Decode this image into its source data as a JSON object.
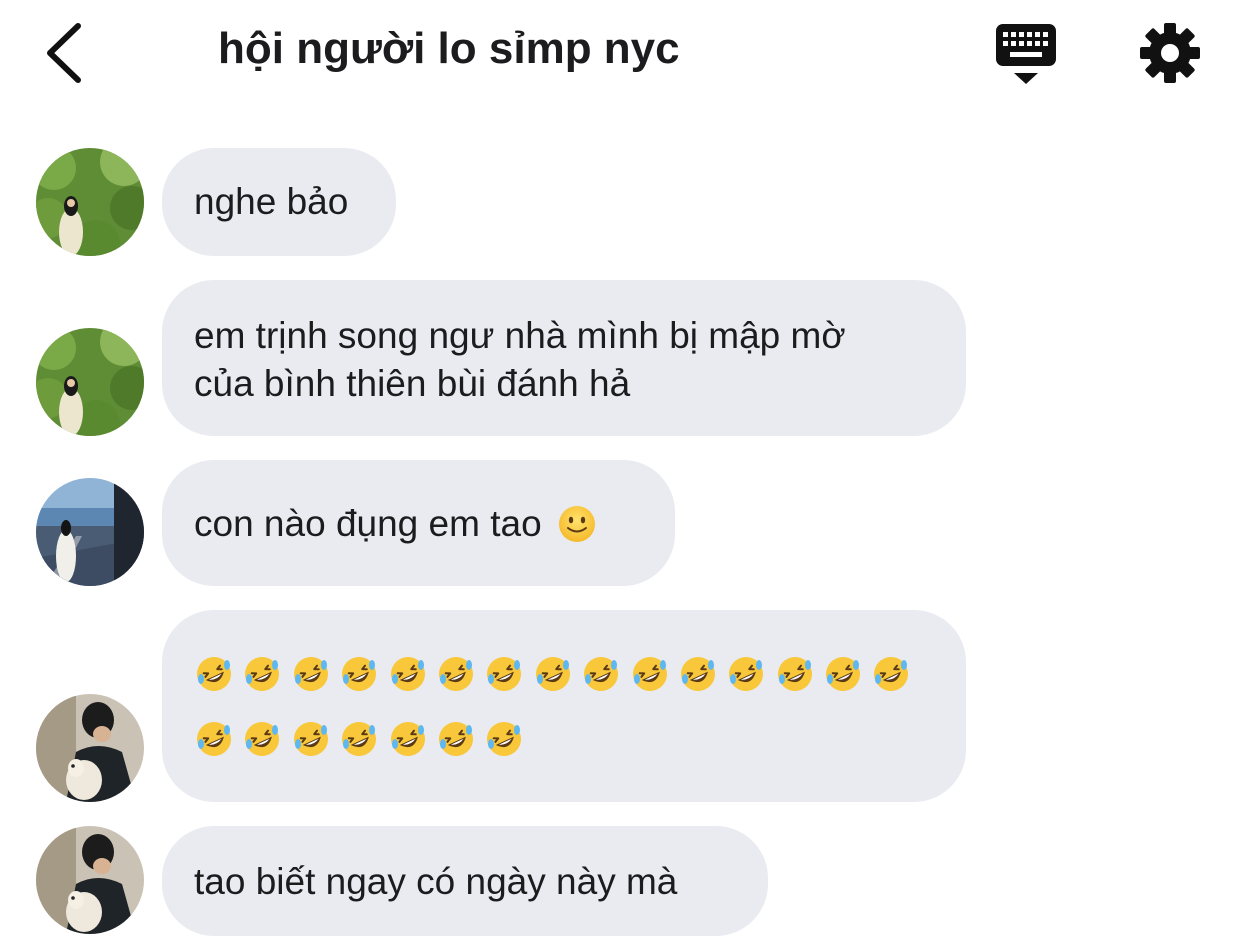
{
  "header": {
    "title": "hội người lo sỉmp nyc",
    "back_icon": "chevron-left-icon",
    "keyboard_icon": "keyboard-icon",
    "settings_icon": "gear-icon"
  },
  "messages": [
    {
      "text": "nghe bảo",
      "avatar": "avatar-girl-garden"
    },
    {
      "text": "em trịnh song ngư nhà mình bị mập mờ\ncủa bình thiên bùi đánh hả",
      "avatar": "avatar-girl-garden"
    },
    {
      "text": "con nào đụng em tao",
      "emoji": "slightly-smiling-face",
      "avatar": "avatar-girl-street"
    },
    {
      "emoji": "rolling-on-floor-laughing",
      "emoji_count": 22,
      "emoji_rows": [
        15,
        7
      ],
      "avatar": "avatar-boy-dog"
    },
    {
      "text": "tao biết ngay có ngày này mà",
      "avatar": "avatar-boy-dog"
    }
  ],
  "colors": {
    "bubble": "#e9ebf0",
    "text": "#1c1c1e",
    "background": "#ffffff"
  }
}
